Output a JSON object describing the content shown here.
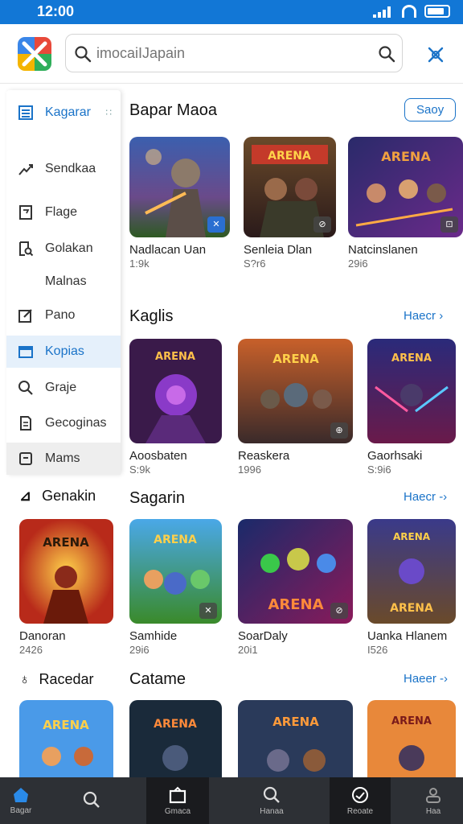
{
  "status": {
    "time": "12:00"
  },
  "search": {
    "placeholder": "imocaiIJapain"
  },
  "sidebar": {
    "items": [
      {
        "label": "Kagarar",
        "icon": "list-icon"
      },
      {
        "label": "Sendkaa",
        "icon": "trend-icon"
      },
      {
        "label": "Flage",
        "icon": "flag-icon"
      },
      {
        "label": "Golakan",
        "icon": "document-search-icon"
      },
      {
        "label": "Malnas",
        "icon": ""
      },
      {
        "label": "Pano",
        "icon": "edit-icon"
      },
      {
        "label": "Kopias",
        "icon": "folder-icon"
      },
      {
        "label": "Graje",
        "icon": "search-icon"
      },
      {
        "label": "Gecoginas",
        "icon": "file-icon"
      },
      {
        "label": "Mams",
        "icon": "archive-icon"
      }
    ]
  },
  "sections": [
    {
      "title": "Bapar Maoa",
      "action": "Saoy",
      "games": [
        {
          "name": "Nadlacan Uan",
          "sub": "1:9k"
        },
        {
          "name": "Senleia Dlan",
          "sub": "S?r6"
        },
        {
          "name": "Natcinslanen",
          "sub": "29i6"
        }
      ]
    },
    {
      "title": "Kaglis",
      "action": "Haecr",
      "games": [
        {
          "name": "Aoosbaten",
          "sub": "S:9k"
        },
        {
          "name": "Reaskera",
          "sub": "1996"
        },
        {
          "name": "Gaorhsaki",
          "sub": "S:9i6"
        }
      ]
    },
    {
      "title": "Sagarin",
      "action": "Haecr",
      "leftLabel": "Genakin",
      "games": [
        {
          "name": "Danoran",
          "sub": "2426"
        },
        {
          "name": "Samhide",
          "sub": "29i6"
        },
        {
          "name": "SoarDaly",
          "sub": "20i1"
        },
        {
          "name": "Uanka Hlanem",
          "sub": "I526"
        }
      ]
    },
    {
      "title": "Catame",
      "action": "Haeer",
      "leftLabel": "Racedar"
    }
  ],
  "bottom_nav": [
    {
      "label": "Bagar",
      "icon": "home-icon"
    },
    {
      "label": "",
      "icon": "search-icon"
    },
    {
      "label": "Gmaca",
      "icon": "library-icon"
    },
    {
      "label": "Hanaa",
      "icon": "search-icon"
    },
    {
      "label": "Reoate",
      "icon": "clock-icon"
    },
    {
      "label": "Haa",
      "icon": "profile-icon"
    }
  ],
  "colors": {
    "accent": "#1a73c8",
    "statusBar": "#1277d6",
    "nav": "#2d3035"
  }
}
